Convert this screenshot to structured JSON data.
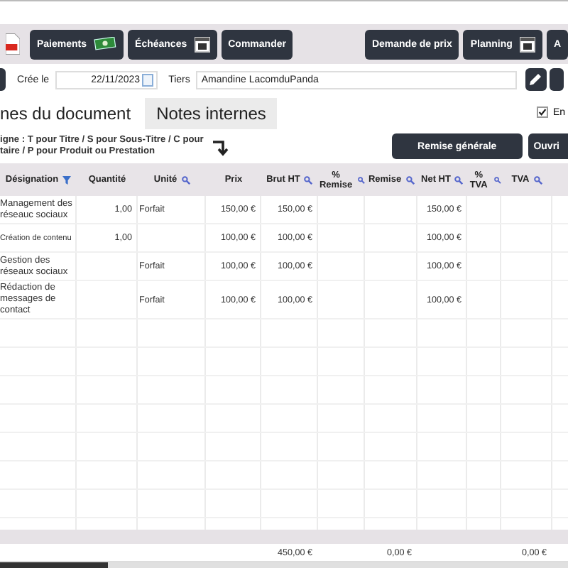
{
  "toolbar": {
    "left": [
      {
        "kind": "pdf"
      },
      {
        "kind": "money",
        "label": "Paiements"
      },
      {
        "kind": "calendar",
        "label": "Échéances"
      },
      {
        "kind": "plain",
        "label": "Commander"
      }
    ],
    "right": [
      {
        "kind": "plain",
        "label": "Demande de prix"
      },
      {
        "kind": "calendar",
        "label": "Planning"
      },
      {
        "kind": "plain",
        "label": "A"
      }
    ]
  },
  "header_fields": {
    "created_label": "Crée le",
    "created_value": "22/11/2023",
    "tiers_label": "Tiers",
    "tiers_value": "Amandine LacomduPanda"
  },
  "tabs": [
    {
      "label": "nes du document",
      "selected": true
    },
    {
      "label": "Notes internes",
      "selected": false
    }
  ],
  "option": {
    "label": "En",
    "checked": true
  },
  "hint": [
    "igne : T pour Titre / S pour Sous-Titre  / C pour",
    "taire /  P pour Produit ou Prestation"
  ],
  "actions": [
    "Remise générale",
    "Ouvri"
  ],
  "table": {
    "columns": [
      {
        "label": "Désignation",
        "filterable": true,
        "searchable": false
      },
      {
        "label": "Quantité",
        "filterable": false,
        "searchable": false
      },
      {
        "label": "Unité",
        "filterable": false,
        "searchable": true
      },
      {
        "label": "Prix",
        "filterable": false,
        "searchable": false
      },
      {
        "label": "Brut HT",
        "filterable": false,
        "searchable": true
      },
      {
        "label": "% Remise",
        "filterable": false,
        "searchable": true
      },
      {
        "label": "Remise",
        "filterable": false,
        "searchable": true
      },
      {
        "label": "Net HT",
        "filterable": false,
        "searchable": true
      },
      {
        "label": "% TVA",
        "filterable": false,
        "searchable": true
      },
      {
        "label": "TVA",
        "filterable": false,
        "searchable": true
      }
    ],
    "rows": [
      {
        "designation": "Management des réseauc sociaux",
        "quantite": "1,00",
        "unite": "Forfait",
        "prix": "150,00 €",
        "brut_ht": "150,00 €",
        "net_ht": "150,00 €"
      },
      {
        "designation": "Création de contenu",
        "quantite": "1,00",
        "prix": "100,00 €",
        "brut_ht": "100,00 €",
        "net_ht": "100,00 €"
      },
      {
        "designation": "Gestion des réseaux sociaux",
        "unite": "Forfait",
        "prix": "100,00 €",
        "brut_ht": "100,00 €",
        "net_ht": "100,00 €"
      },
      {
        "designation": "Rédaction de messages de contact",
        "unite": "Forfait",
        "prix": "100,00 €",
        "brut_ht": "100,00 €",
        "net_ht": "100,00 €"
      }
    ],
    "totals": {
      "brut_ht": "450,00 €",
      "remise": "0,00 €",
      "tva": "0,00 €"
    }
  }
}
